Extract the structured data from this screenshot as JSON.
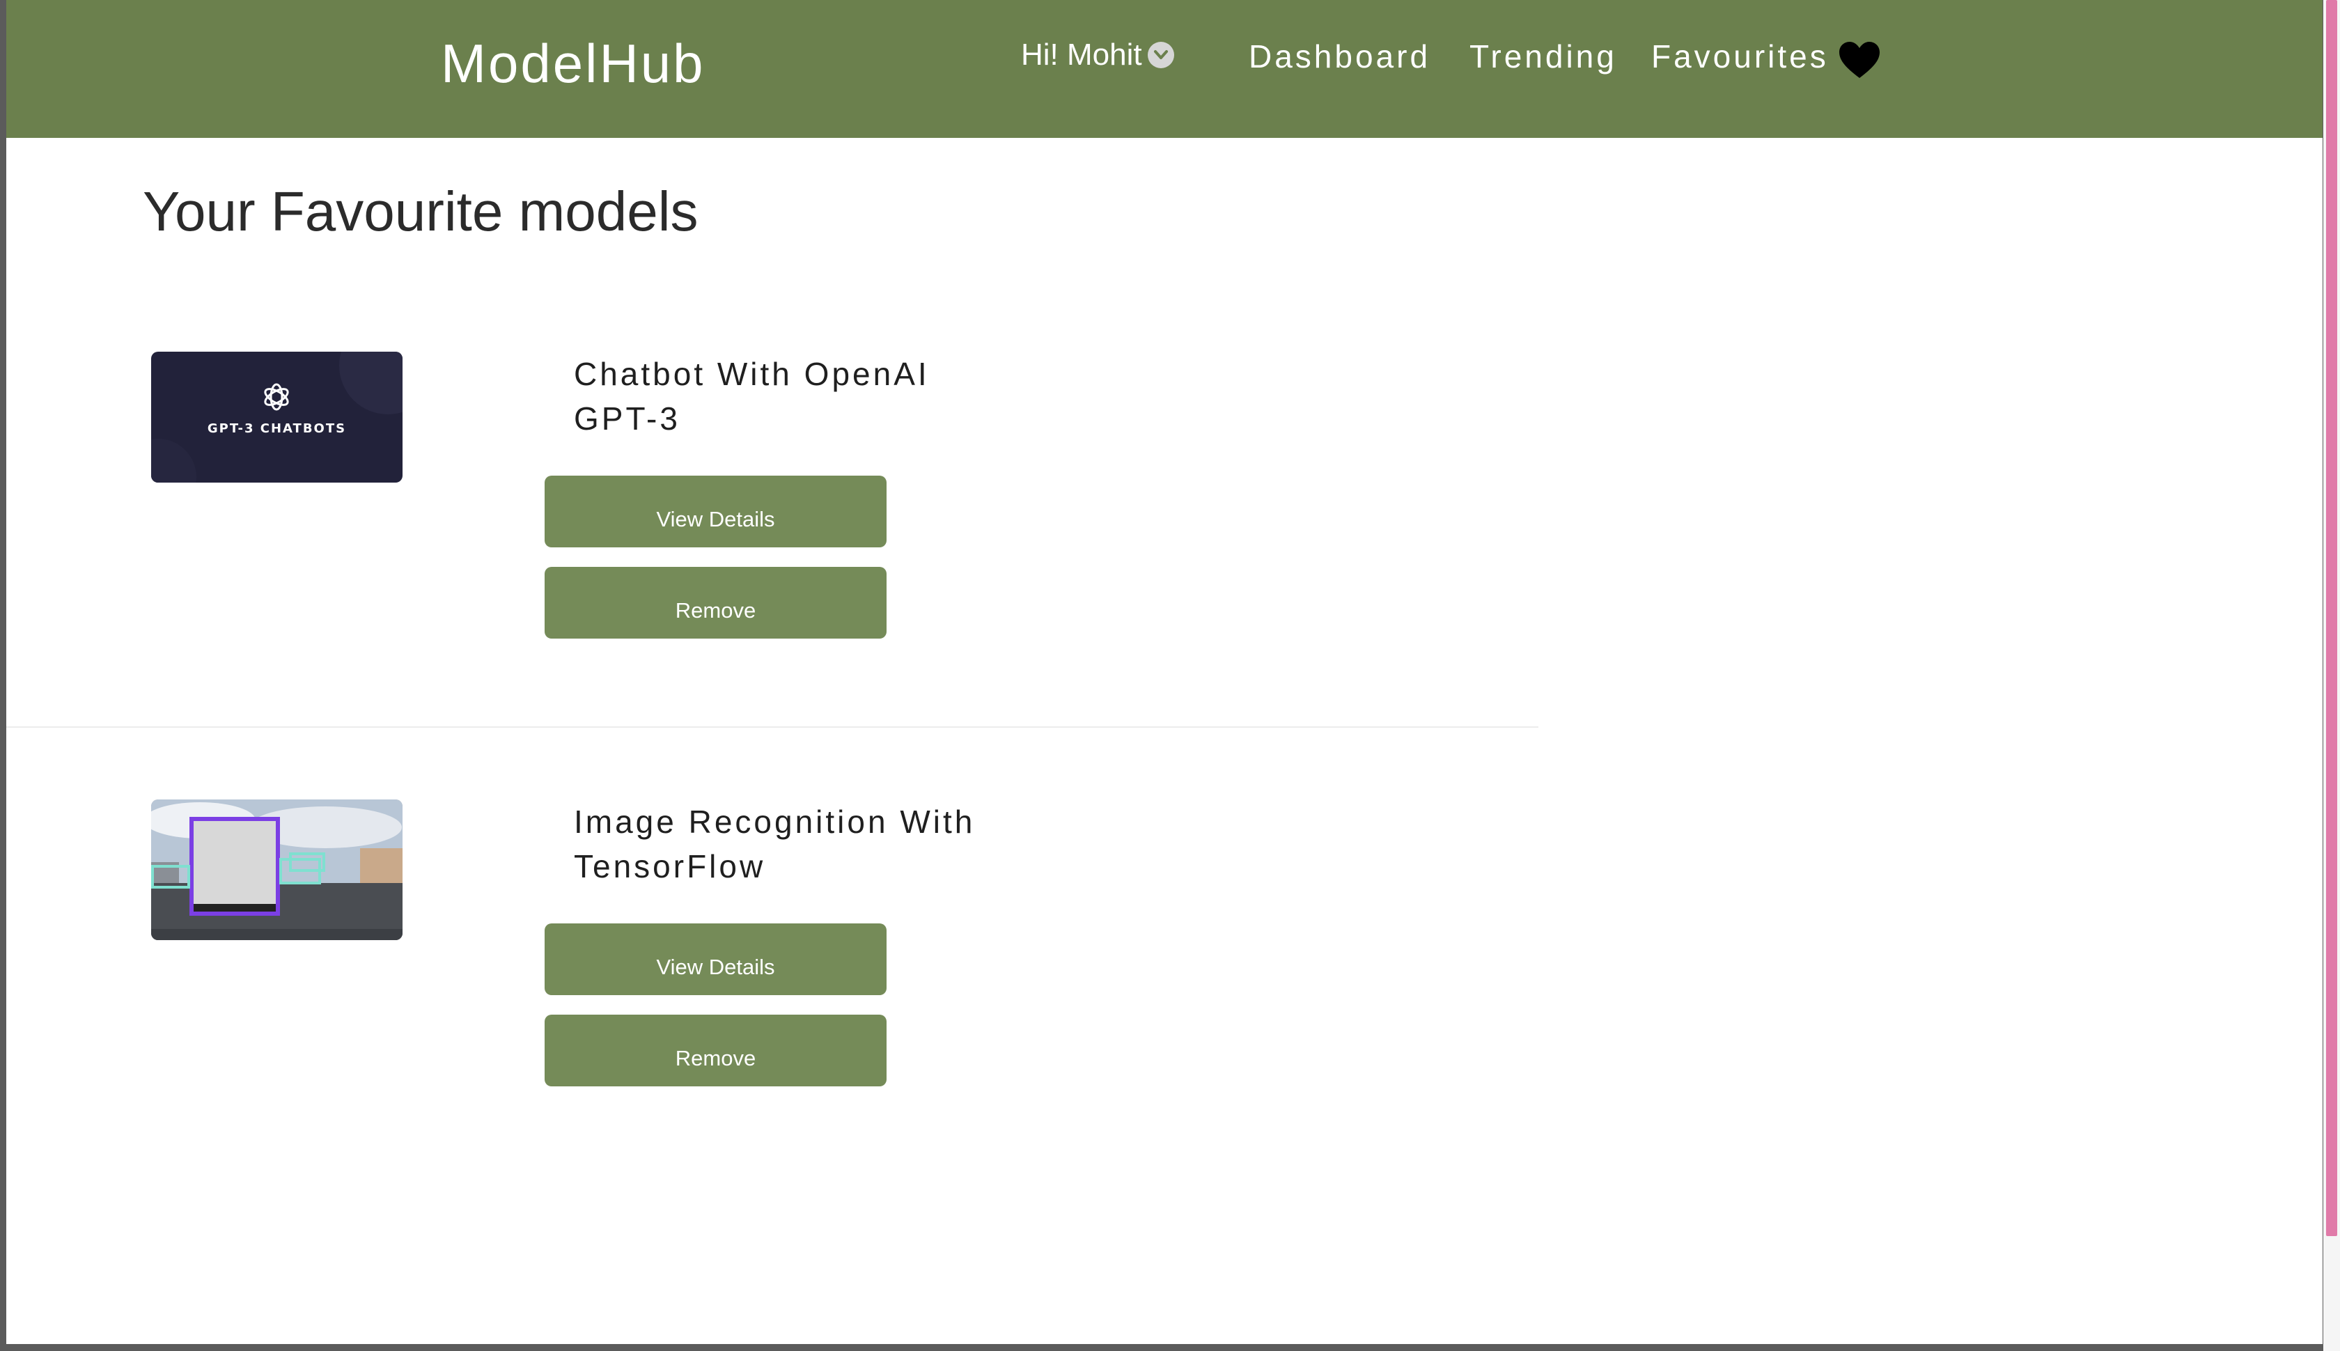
{
  "navbar": {
    "brand": "ModelHub",
    "greeting": "Hi! Mohit",
    "links": [
      "Dashboard",
      "Trending",
      "Favourites"
    ],
    "background": "#6b804d"
  },
  "page": {
    "title": "Your Favourite models"
  },
  "models": [
    {
      "title": "Chatbot With OpenAI GPT-3",
      "thumbnail_text": "GPT-3 CHATBOTS",
      "view_label": "View Details",
      "remove_label": "Remove"
    },
    {
      "title": "Image Recognition With TensorFlow",
      "view_label": "View Details",
      "remove_label": "Remove"
    }
  ],
  "colors": {
    "button": "#758b58",
    "scrollbar_thumb": "#e07aa8"
  },
  "icons": {
    "user_menu": "chevron-down-icon",
    "favourites": "heart-icon",
    "gpt_logo": "openai-logo-icon"
  }
}
